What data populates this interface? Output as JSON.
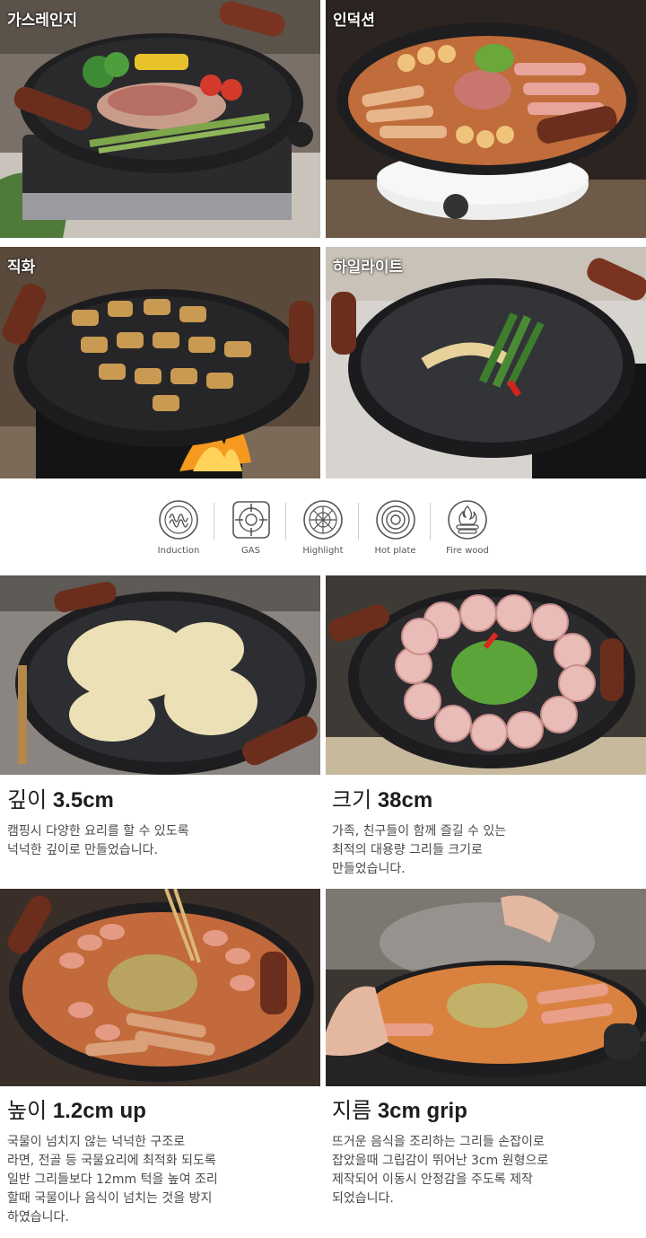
{
  "heat_label_top": {
    "gas_range": "가스레인지",
    "induction": "인덕션",
    "direct_fire": "직화",
    "highlight": "하일라이트"
  },
  "heat_sources": [
    {
      "label": "Induction",
      "icon": "induction-icon"
    },
    {
      "label": "GAS",
      "icon": "gas-burner-icon"
    },
    {
      "label": "Highlight",
      "icon": "highlight-icon"
    },
    {
      "label": "Hot plate",
      "icon": "hot-plate-icon"
    },
    {
      "label": "Fire wood",
      "icon": "fire-wood-icon"
    }
  ],
  "features": [
    {
      "title_prefix": "깊이 ",
      "title_value": "3.5cm",
      "desc": "캠핑시 다양한 요리를 할 수 있도록\n넉넉한 깊이로 만들었습니다."
    },
    {
      "title_prefix": "크기 ",
      "title_value": "38cm",
      "desc": "가족, 친구들이 함께 즐길 수 있는\n최적의 대용량 그리들 크기로\n만들었습니다."
    },
    {
      "title_prefix": "높이 ",
      "title_value": "1.2cm up",
      "desc": "국물이 넘치지 않는 넉넉한 구조로\n라면, 전골 등 국물요리에 최적화 되도록\n일반 그리들보다 12mm 턱을 높여 조리\n할때 국물이나 음식이 넘치는 것을 방지\n하였습니다."
    },
    {
      "title_prefix": "지름 ",
      "title_value": "3cm grip",
      "desc": "뜨거운 음식을 조리하는 그리들 손잡이로\n잡았을때 그립감이 뛰어난 3cm 원형으로\n제작되어 이동시 안정감을 주도록 제작\n되었습니다."
    }
  ],
  "colors": {
    "text_dark": "#1d1d1d",
    "text_body": "#4a4a4a",
    "pan": "#1e1e20",
    "handle": "#6b2e1c"
  }
}
